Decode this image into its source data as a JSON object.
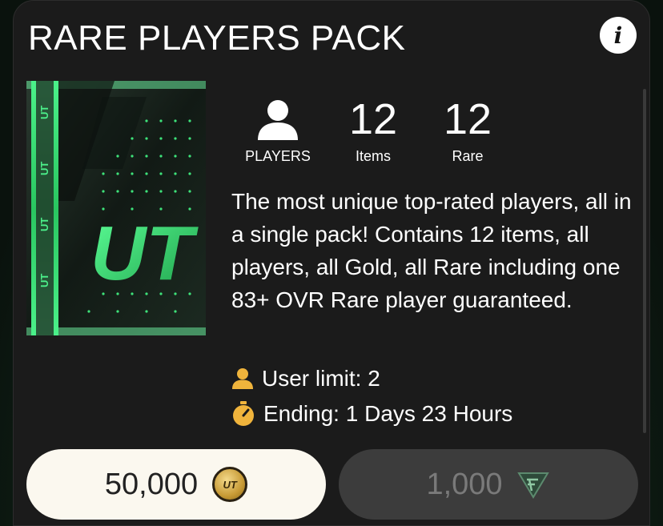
{
  "pack": {
    "title": "RARE PLAYERS PACK",
    "info_label": "i"
  },
  "stats": {
    "type_label": "PLAYERS",
    "items_count": "12",
    "items_label": "Items",
    "rare_count": "12",
    "rare_label": "Rare"
  },
  "description": "The most unique top-rated players, all in a single pack! Contains 12 items, all players, all Gold, all Rare including one 83+ OVR Rare player guaranteed.",
  "meta": {
    "user_limit": "User limit: 2",
    "ending": "Ending: 1 Days 23 Hours"
  },
  "prices": {
    "coins": "50,000",
    "coin_icon_text": "UT",
    "points": "1,000"
  },
  "colors": {
    "accent_gold": "#f0b43c",
    "pack_green": "#2ee06a",
    "card_bg": "#1b1b1b"
  },
  "icons": {
    "info": "info-icon",
    "player": "player-silhouette-icon",
    "user_limit": "user-icon",
    "ending": "stopwatch-icon",
    "coin": "ut-coin-icon",
    "points": "fc-points-icon"
  },
  "pack_art": {
    "logo_text": "UT",
    "strip_text": "UT"
  }
}
